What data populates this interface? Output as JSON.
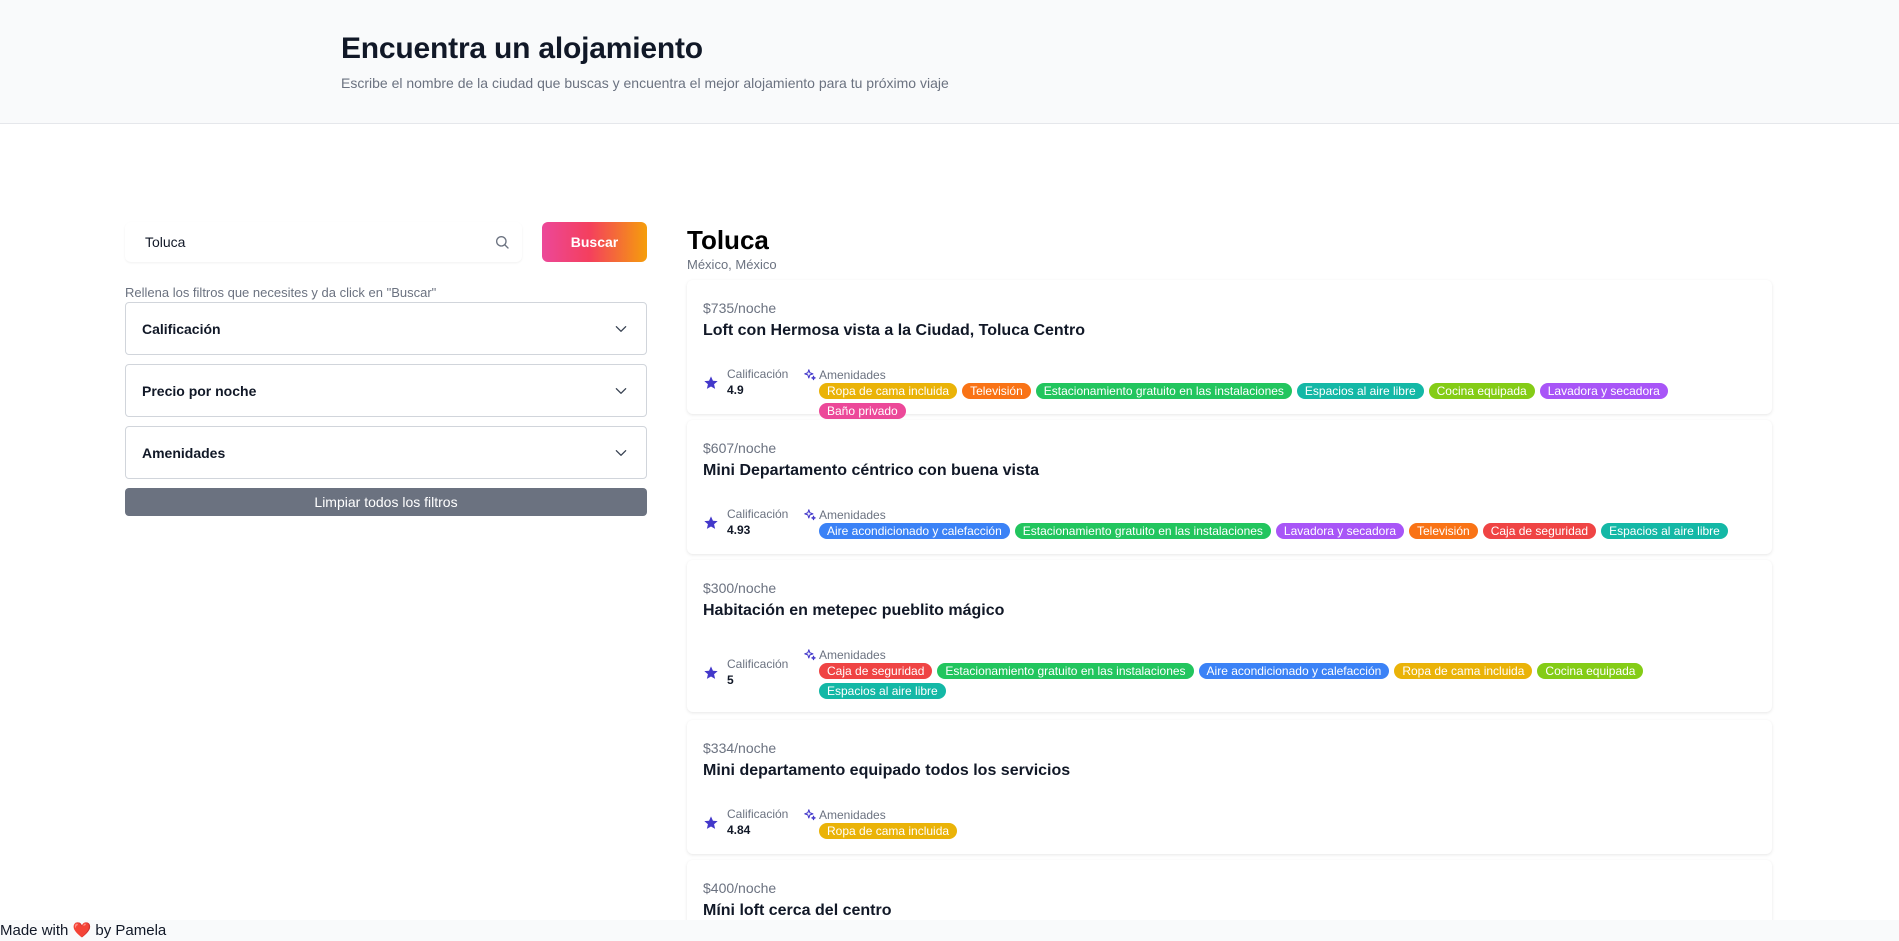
{
  "header": {
    "title": "Encuentra un alojamiento",
    "subtitle": "Escribe el nombre de la ciudad que buscas y encuentra el mejor alojamiento para tu próximo viaje"
  },
  "search": {
    "value": "Toluca",
    "button_label": "Buscar"
  },
  "filters": {
    "hint": "Rellena los filtros que necesites y da click en \"Buscar\"",
    "items": [
      {
        "label": "Calificación"
      },
      {
        "label": "Precio por noche"
      },
      {
        "label": "Amenidades"
      }
    ],
    "clear_label": "Limpiar todos los filtros"
  },
  "results": {
    "city": "Toluca",
    "location": "México, México",
    "rating_label": "Calificación",
    "amenities_label": "Amenidades",
    "listings": [
      {
        "price": "$735/noche",
        "title": "Loft con Hermosa vista a la Ciudad, Toluca Centro",
        "rating": "4.9",
        "amenities": [
          {
            "name": "Ropa de cama incluida",
            "color": "#eab308"
          },
          {
            "name": "Televisión",
            "color": "#f97316"
          },
          {
            "name": "Estacionamiento gratuito en las instalaciones",
            "color": "#22c55e"
          },
          {
            "name": "Espacios al aire libre",
            "color": "#14b8a6"
          },
          {
            "name": "Cocina equipada",
            "color": "#84cc16"
          },
          {
            "name": "Lavadora y secadora",
            "color": "#a855f7"
          },
          {
            "name": "Baño privado",
            "color": "#ec4899"
          }
        ]
      },
      {
        "price": "$607/noche",
        "title": "Mini Departamento céntrico con buena vista",
        "rating": "4.93",
        "amenities": [
          {
            "name": "Aire acondicionado y calefacción",
            "color": "#3b82f6"
          },
          {
            "name": "Estacionamiento gratuito en las instalaciones",
            "color": "#22c55e"
          },
          {
            "name": "Lavadora y secadora",
            "color": "#a855f7"
          },
          {
            "name": "Televisión",
            "color": "#f97316"
          },
          {
            "name": "Caja de seguridad",
            "color": "#ef4444"
          },
          {
            "name": "Espacios al aire libre",
            "color": "#14b8a6"
          }
        ]
      },
      {
        "price": "$300/noche",
        "title": "Habitación en metepec pueblito mágico",
        "rating": "5",
        "amenities": [
          {
            "name": "Caja de seguridad",
            "color": "#ef4444"
          },
          {
            "name": "Estacionamiento gratuito en las instalaciones",
            "color": "#22c55e"
          },
          {
            "name": "Aire acondicionado y calefacción",
            "color": "#3b82f6"
          },
          {
            "name": "Ropa de cama incluida",
            "color": "#eab308"
          },
          {
            "name": "Cocina equipada",
            "color": "#84cc16"
          },
          {
            "name": "Espacios al aire libre",
            "color": "#14b8a6"
          }
        ]
      },
      {
        "price": "$334/noche",
        "title": "Mini departamento equipado todos los servicios",
        "rating": "4.84",
        "amenities": [
          {
            "name": "Ropa de cama incluida",
            "color": "#eab308"
          }
        ]
      },
      {
        "price": "$400/noche",
        "title": "Míni loft cerca del centro",
        "rating": "",
        "amenities": []
      }
    ]
  },
  "footer": {
    "prefix": "Made with",
    "heart": "❤️",
    "suffix": "by Pamela"
  },
  "colors": {
    "accent": "#4338ca",
    "button_gradient_start": "#ec4899",
    "button_gradient_end": "#f59e0b",
    "clear_button": "#6b7280"
  }
}
